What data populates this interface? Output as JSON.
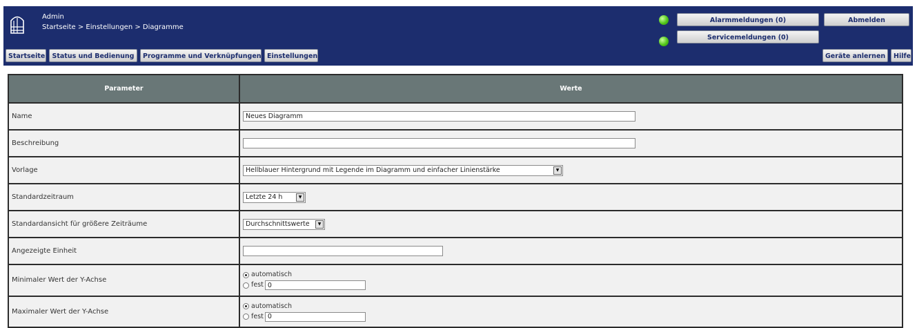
{
  "header": {
    "user": "Admin",
    "breadcrumb": "Startseite > Einstellungen > Diagramme",
    "alarm_label": "Alarmmeldungen (0)",
    "service_label": "Servicemeldungen (0)",
    "logout_label": "Abmelden",
    "learn_devices_label": "Geräte anlernen",
    "help_label": "Hilfe",
    "led_color": "#52c61b",
    "nav": [
      "Startseite",
      "Status und Bedienung",
      "Programme und Verknüpfungen",
      "Einstellungen"
    ]
  },
  "table": {
    "col_param": "Parameter",
    "col_values": "Werte",
    "rows": {
      "name_label": "Name",
      "name_value": "Neues Diagramm",
      "desc_label": "Beschreibung",
      "desc_value": "",
      "template_label": "Vorlage",
      "template_value": "Hellblauer Hintergrund mit Legende im Diagramm und einfacher Linienstärke",
      "period_label": "Standardzeitraum",
      "period_value": "Letzte 24 h",
      "view_label": "Standardansicht für größere Zeiträume",
      "view_value": "Durchschnittswerte",
      "unit_label": "Angezeigte Einheit",
      "unit_value": "",
      "ymin_label": "Minimaler Wert der Y-Achse",
      "ymax_label": "Maximaler Wert der Y-Achse",
      "auto_label": "automatisch",
      "fixed_label": "fest",
      "ymin_value": "0",
      "ymax_value": "0",
      "ymin_mode": "automatisch",
      "ymax_mode": "automatisch"
    }
  }
}
